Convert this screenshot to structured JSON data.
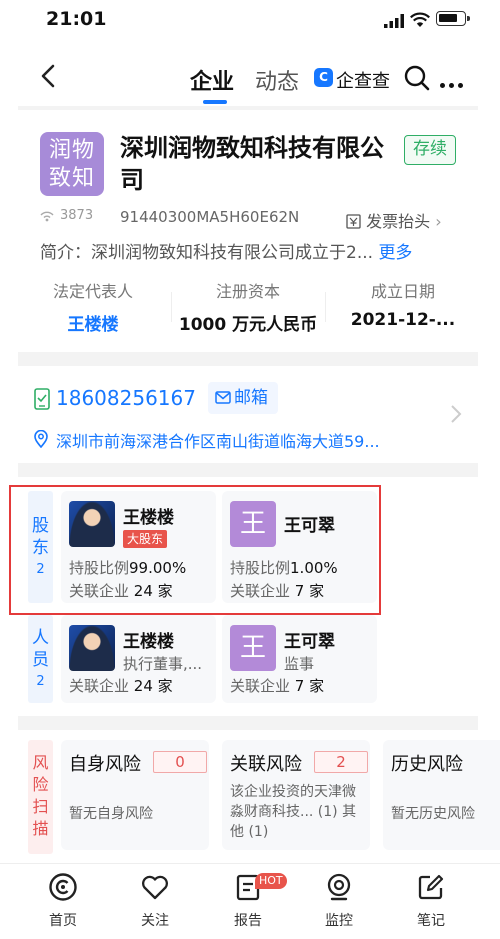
{
  "status_bar": {
    "time": "21:01"
  },
  "nav": {
    "tab_company": "企业",
    "tab_dynamics": "动态",
    "brand_name": "企查查",
    "brand_logo_letter": "C"
  },
  "company": {
    "logo_text_1": "润物",
    "logo_text_2": "致知",
    "name": "深圳润物致知科技有限公司",
    "status": "存续",
    "views": "3873",
    "credit_code": "91440300MA5H60E62N",
    "invoice_label": "发票抬头",
    "intro_label": "简介：",
    "intro_text": "深圳润物致知科技有限公司成立于2...",
    "intro_more": "更多"
  },
  "stats": {
    "legal_rep_label": "法定代表人",
    "legal_rep_value": "王楼楼",
    "capital_label": "注册资本",
    "capital_value": "1000 万元人民币",
    "date_label": "成立日期",
    "date_value": "2021-12-..."
  },
  "contact": {
    "phone": "18608256167",
    "email_label": "邮箱",
    "address": "深圳市前海深港合作区南山街道临海大道59..."
  },
  "shareholders": {
    "side_label": "股东",
    "count": "2",
    "items": [
      {
        "name": "王楼楼",
        "badge": "大股东",
        "share_label": "持股比例",
        "share_value": "99.00%",
        "rel_label": "关联企业",
        "rel_value": "24 家"
      },
      {
        "name": "王可翠",
        "avatar_letter": "王",
        "share_label": "持股比例",
        "share_value": "1.00%",
        "rel_label": "关联企业",
        "rel_value": "7 家"
      }
    ]
  },
  "personnel": {
    "side_label": "人员",
    "count": "2",
    "items": [
      {
        "name": "王楼楼",
        "role": "执行董事,...",
        "rel_label": "关联企业",
        "rel_value": "24 家"
      },
      {
        "name": "王可翠",
        "avatar_letter": "王",
        "role": "监事",
        "rel_label": "关联企业",
        "rel_value": "7 家"
      }
    ]
  },
  "risk": {
    "side_label": "风险扫描",
    "items": [
      {
        "title": "自身风险",
        "count": "0",
        "desc": "暂无自身风险"
      },
      {
        "title": "关联风险",
        "count": "2",
        "desc": "该企业投资的天津微淼财商科技... (1) 其他 (1)"
      },
      {
        "title": "历史风险",
        "desc": "暂无历史风险"
      }
    ]
  },
  "tabbar": {
    "home": "首页",
    "follow": "关注",
    "report": "报告",
    "report_badge": "HOT",
    "monitor": "监控",
    "notes": "笔记"
  },
  "colors": {
    "accent": "#1677ff",
    "status_green": "#2fae66",
    "risk_red": "#e35050",
    "highlight_border": "#e43a3a"
  }
}
